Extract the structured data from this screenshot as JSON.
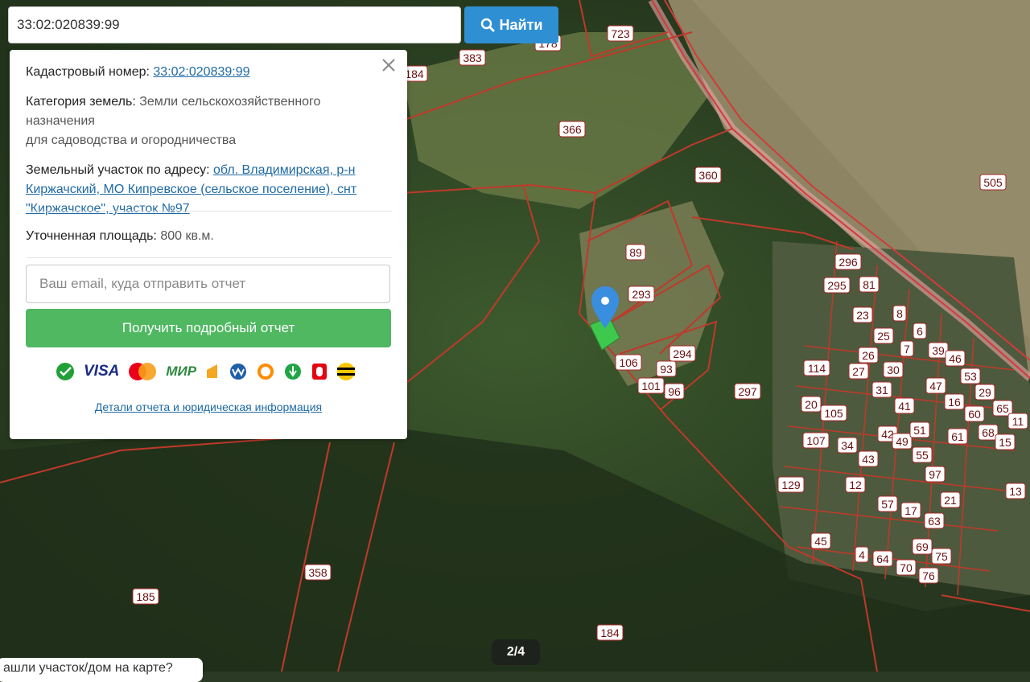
{
  "search": {
    "value": "33:02:020839:99",
    "button_label": "Найти"
  },
  "info": {
    "cadastral_label": "Кадастровый номер:",
    "cadastral_value": "33:02:020839:99",
    "category_label": "Категория земель:",
    "category_value": "Земли сельскохозяйственного назначения",
    "usage_value": "для садоводства и огородничества",
    "address_label": "Земельный участок по адресу:",
    "address_value": "обл. Владимирская, р-н Киржачский, МО Кипревское (сельское поселение), снт \"Киржачское\", участок №97",
    "area_label": "Уточненная площадь:",
    "area_value": "800 кв.м."
  },
  "report": {
    "email_placeholder": "Ваш email, куда отправить отчет",
    "button_label": "Получить подробный отчет",
    "details_link": "Детали отчета и юридическая информация",
    "payments": [
      "sber-icon",
      "VISA",
      "mastercard-icon",
      "МИР",
      "yandex-money-icon",
      "webmoney-icon",
      "qiwi-icon",
      "sberpay-icon",
      "mts-icon",
      "beeline-icon"
    ]
  },
  "map": {
    "parcel_labels": [
      "723",
      "383",
      "178",
      "184",
      "366",
      "360",
      "505",
      "89",
      "293",
      "294",
      "106",
      "93",
      "101",
      "96",
      "297",
      "295",
      "296",
      "81",
      "23",
      "8",
      "25",
      "6",
      "26",
      "7",
      "39",
      "46",
      "114",
      "27",
      "30",
      "47",
      "53",
      "29",
      "20",
      "105",
      "31",
      "41",
      "16",
      "60",
      "65",
      "11",
      "107",
      "34",
      "42",
      "49",
      "51",
      "61",
      "68",
      "12",
      "43",
      "55",
      "15",
      "13",
      "45",
      "4",
      "57",
      "17",
      "63",
      "21",
      "64",
      "70",
      "69",
      "75",
      "76",
      "97",
      "129",
      "358",
      "185",
      "184"
    ],
    "page_indicator": "2/4",
    "bottom_note": "ашли участок/дом на карте?"
  },
  "colors": {
    "accent": "#2f8fd3",
    "report_green": "#4fb861",
    "boundary": "#c0392b",
    "link": "#1f6aa5"
  }
}
